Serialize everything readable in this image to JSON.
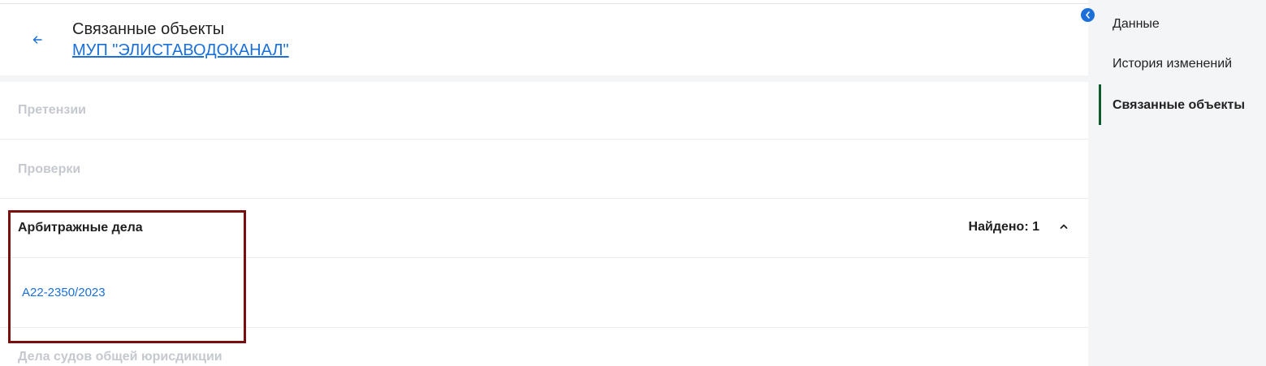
{
  "header": {
    "back_icon": "arrow-left-icon",
    "title": "Связанные объекты",
    "subtitle": "МУП \"ЭЛИСТАВОДОКАНАЛ\""
  },
  "sections": [
    {
      "label": "Претензии",
      "state": "empty"
    },
    {
      "label": "Проверки",
      "state": "empty"
    },
    {
      "label": "Арбитражные дела",
      "state": "expanded",
      "found": "Найдено: 1",
      "items": [
        "А22-2350/2023"
      ]
    },
    {
      "label": "Дела судов общей юрисдикции",
      "state": "empty"
    }
  ],
  "sidebar": {
    "collapse_icon": "chevron-left-icon",
    "items": [
      {
        "label": "Данные"
      },
      {
        "label": "История изменений"
      },
      {
        "label": "Связанные объекты",
        "selected": true
      }
    ]
  },
  "colors": {
    "link": "#1a6fd8",
    "muted_text": "#c5c9cf",
    "highlight_border": "#7a0d0d",
    "nav_indicator": "#0f5a2a",
    "sidebar_bg": "#f4f5f7"
  }
}
